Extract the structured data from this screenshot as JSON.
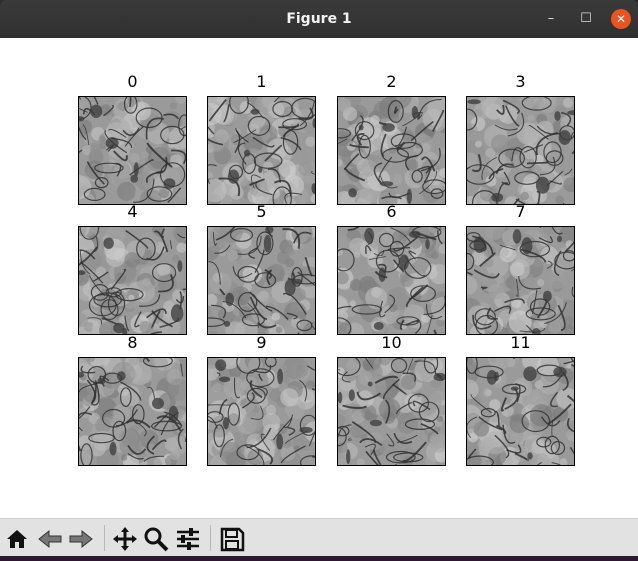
{
  "window": {
    "title": "Figure 1"
  },
  "figure": {
    "panels": [
      {
        "label": "0"
      },
      {
        "label": "1"
      },
      {
        "label": "2"
      },
      {
        "label": "3"
      },
      {
        "label": "4"
      },
      {
        "label": "5"
      },
      {
        "label": "6"
      },
      {
        "label": "7"
      },
      {
        "label": "8"
      },
      {
        "label": "9"
      },
      {
        "label": "10"
      },
      {
        "label": "11"
      }
    ]
  },
  "toolbar": {
    "tools": [
      "home-icon",
      "back-icon",
      "forward-icon",
      "pan-icon",
      "zoom-icon",
      "configure-subplots-icon",
      "save-icon"
    ]
  }
}
